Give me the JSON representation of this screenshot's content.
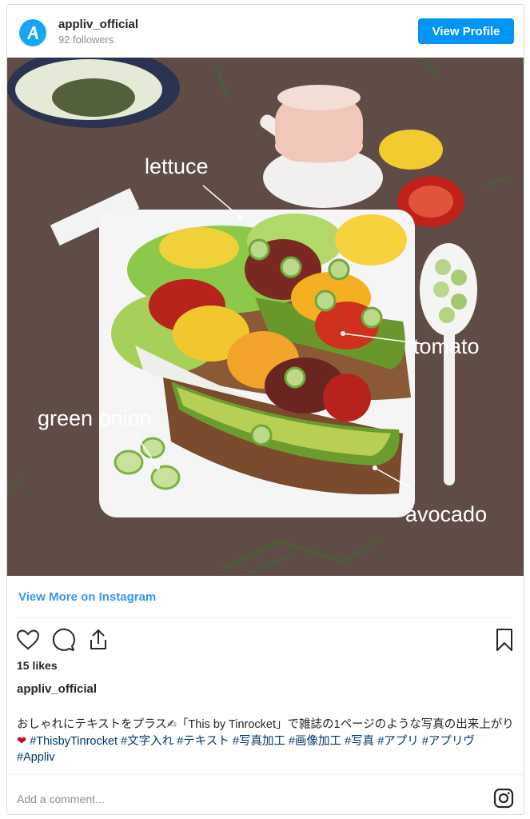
{
  "header": {
    "username": "appliv_official",
    "followers": "92 followers",
    "view_profile_label": "View Profile"
  },
  "photo": {
    "labels": {
      "lettuce": "lettuce",
      "tomato": "tomato",
      "green_onion": "green onion",
      "avocado": "avocado"
    }
  },
  "view_more_label": "View More on Instagram",
  "likes": "15 likes",
  "author": "appliv_official",
  "caption": {
    "line1": "おしゃれにテキストをプラス",
    "quote": "「This by Tinrocket」で雑誌の1ページのような写真の出来上がり",
    "hashtags": [
      "#ThisbyTinrocket",
      "#文字入れ",
      "#テキスト",
      "#写真加工",
      "#画像加工",
      "#写真",
      "#アプリ",
      "#アプリヴ",
      "#Appliv"
    ]
  },
  "comment": {
    "placeholder": "Add a comment..."
  },
  "colors": {
    "accent": "#0095f6",
    "link": "#3897f0",
    "hashtag": "#00376b"
  }
}
